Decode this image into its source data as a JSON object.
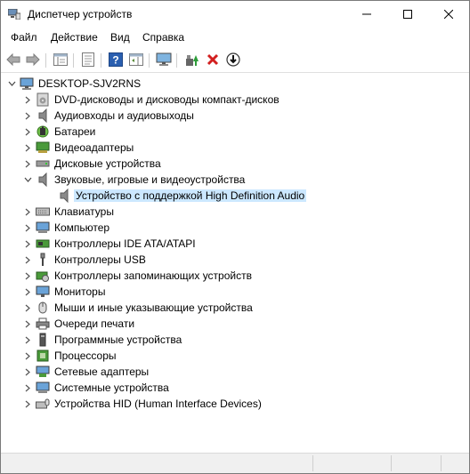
{
  "window": {
    "title": "Диспетчер устройств"
  },
  "menu": {
    "file": "Файл",
    "action": "Действие",
    "view": "Вид",
    "help": "Справка"
  },
  "tree": {
    "root": "DESKTOP-SJV2RNS",
    "categories": [
      "DVD-дисководы и дисководы компакт-дисков",
      "Аудиовходы и аудиовыходы",
      "Батареи",
      "Видеоадаптеры",
      "Дисковые устройства",
      "Звуковые, игровые и видеоустройства",
      "Клавиатуры",
      "Компьютер",
      "Контроллеры IDE ATA/ATAPI",
      "Контроллеры USB",
      "Контроллеры запоминающих устройств",
      "Мониторы",
      "Мыши и иные указывающие устройства",
      "Очереди печати",
      "Программные устройства",
      "Процессоры",
      "Сетевые адаптеры",
      "Системные устройства",
      "Устройства HID (Human Interface Devices)"
    ],
    "selected_child": "Устройство с поддержкой High Definition Audio"
  },
  "colors": {
    "selection": "#cce8ff",
    "delete_red": "#d21f1f",
    "help_blue": "#2a5fb0"
  }
}
